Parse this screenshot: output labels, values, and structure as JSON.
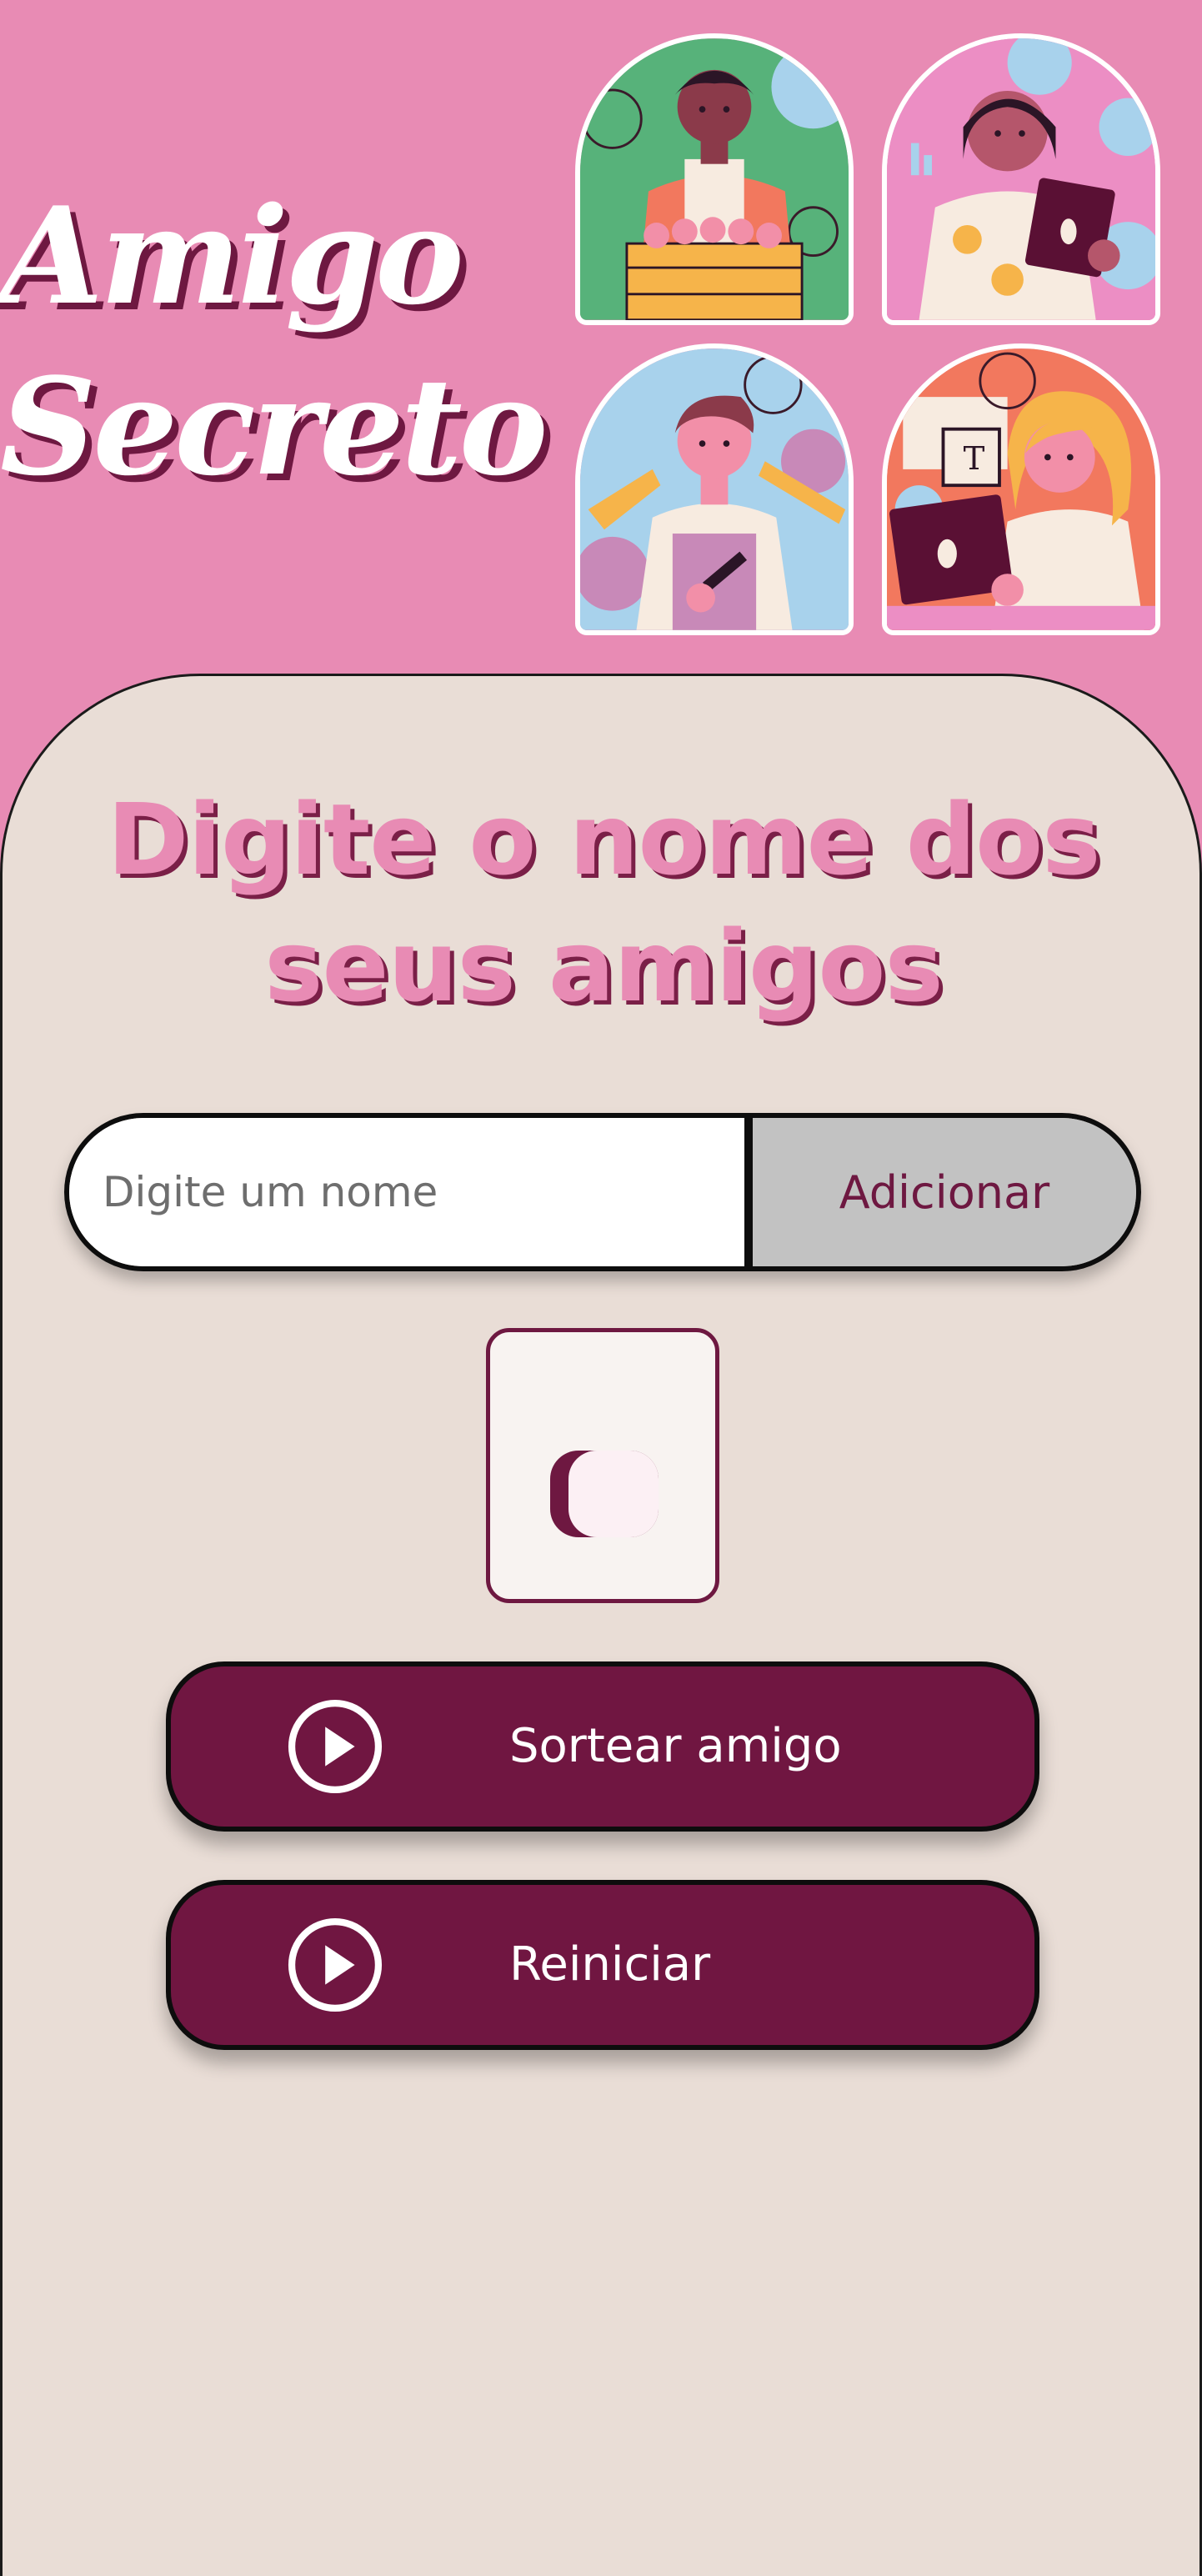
{
  "header": {
    "title_line1": "Amigo",
    "title_line2": "Secreto",
    "stickers": [
      {
        "name": "person-with-fruit-box",
        "bg": "#57B27A"
      },
      {
        "name": "woman-with-tablet",
        "bg": "#EC8EC4"
      },
      {
        "name": "man-with-hammer",
        "bg": "#A8D2EC"
      },
      {
        "name": "woman-with-laptop",
        "bg": "#F2785E"
      }
    ]
  },
  "main": {
    "title": "Digite o nome dos seus amigos",
    "input": {
      "placeholder": "Digite um nome",
      "value": ""
    },
    "add_button": "Adicionar",
    "draw_button": "Sortear amigo",
    "reset_button": "Reiniciar"
  },
  "colors": {
    "background": "#E88BB4",
    "card": "#E9DDD6",
    "accent": "#701641",
    "button_gray": "#C2C2C2"
  }
}
